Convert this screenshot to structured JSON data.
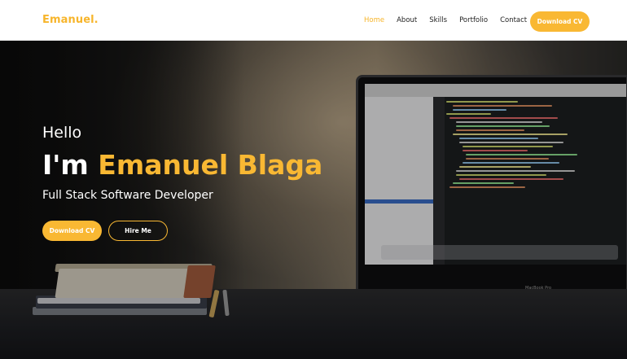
{
  "brand": {
    "name": "Emanuel."
  },
  "nav": {
    "items": [
      {
        "label": "Home",
        "active": true
      },
      {
        "label": "About",
        "active": false
      },
      {
        "label": "Skills",
        "active": false
      },
      {
        "label": "Portfolio",
        "active": false
      },
      {
        "label": "Contact",
        "active": false
      }
    ],
    "cta_label": "Download CV"
  },
  "hero": {
    "greeting": "Hello",
    "intro_prefix": "I'm",
    "name": "Emanuel Blaga",
    "role": "Full Stack Software Developer",
    "primary_button": "Download CV",
    "secondary_button": "Hire Me",
    "background_image": "desk-with-books-and-laptop",
    "laptop_label": "MacBook Pro"
  },
  "colors": {
    "accent": "#f9b833",
    "text_dark": "#1f1f1f",
    "text_light": "#ffffff",
    "navbar_bg": "#ffffff"
  }
}
